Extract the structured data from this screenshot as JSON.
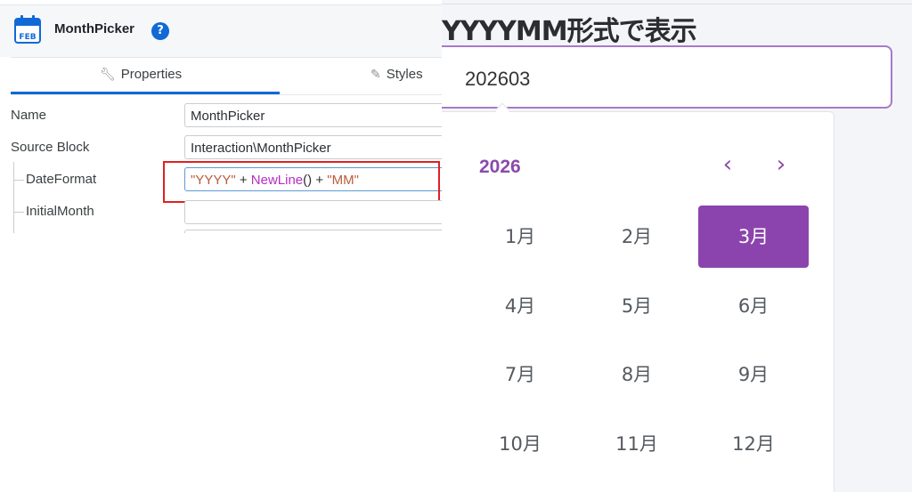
{
  "panel": {
    "title": "MonthPicker",
    "icon_label": "FEB",
    "help_glyph": "?",
    "tabs": [
      {
        "label": "Properties",
        "icon": "wrench-icon",
        "active": true
      },
      {
        "label": "Styles",
        "icon": "brush-icon",
        "active": false
      }
    ],
    "properties": [
      {
        "label": "Name",
        "value": "MonthPicker"
      },
      {
        "label": "Source Block",
        "value": "Interaction\\MonthPicker"
      },
      {
        "label": "DateFormat",
        "expr": {
          "p1": "\"YYYY\"",
          "op1": " + ",
          "fn": "NewLine",
          "paren": "()",
          "op2": " + ",
          "p2": "\"MM\""
        }
      },
      {
        "label": "InitialMonth",
        "value": ""
      }
    ]
  },
  "picker": {
    "heading": "YYYYMM形式で表示",
    "value": "202603",
    "year": "2026",
    "prev_glyph": "‹",
    "next_glyph": "›",
    "months": [
      "1月",
      "2月",
      "3月",
      "4月",
      "5月",
      "6月",
      "7月",
      "8月",
      "9月",
      "10月",
      "11月",
      "12月"
    ],
    "selected_month": "3月",
    "accent_color": "#8b44ad"
  }
}
